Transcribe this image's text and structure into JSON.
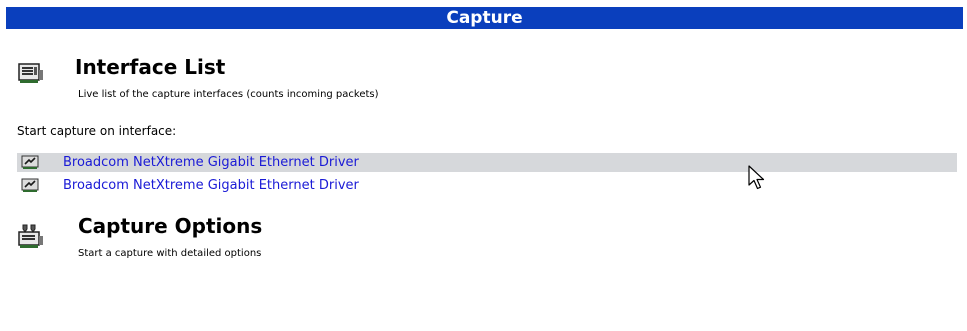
{
  "header": {
    "title": "Capture"
  },
  "interface_list": {
    "title": "Interface List",
    "description": "Live list of the capture interfaces (counts incoming packets)",
    "icon": "interface-list-icon"
  },
  "start_capture": {
    "label": "Start capture on interface:",
    "interfaces": [
      {
        "label": "Broadcom NetXtreme Gigabit Ethernet Driver",
        "hovered": true
      },
      {
        "label": "Broadcom NetXtreme Gigabit Ethernet Driver",
        "hovered": false
      }
    ]
  },
  "capture_options": {
    "title": "Capture Options",
    "description": "Start a capture with detailed options",
    "icon": "capture-options-icon"
  },
  "colors": {
    "header_bg": "#0a3fbd",
    "link": "#1a1ad6",
    "hover_row": "#d6d8db"
  }
}
